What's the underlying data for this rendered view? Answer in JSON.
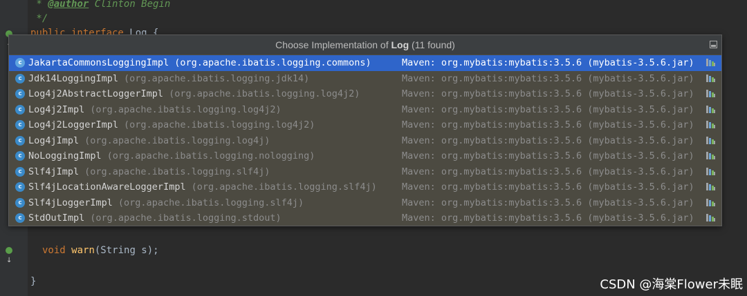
{
  "editor": {
    "comment_author_prefix": " * ",
    "comment_author_tag": "@author",
    "comment_author_name": " Clinton Begin",
    "comment_end": " */",
    "line_decl_kw": "public interface",
    "line_decl_name": " Log {",
    "line_warn_kw": "void",
    "line_warn_fn": "warn",
    "line_warn_rest": "(String s);",
    "closing_brace": "}"
  },
  "popup": {
    "title_prefix": "Choose Implementation of ",
    "title_class": "Log",
    "title_suffix": " (11 found)",
    "items": [
      {
        "name": "JakartaCommonsLoggingImpl",
        "package": "(org.apache.ibatis.logging.commons)",
        "library": "Maven: org.mybatis:mybatis:3.5.6 (mybatis-3.5.6.jar)",
        "selected": true
      },
      {
        "name": "Jdk14LoggingImpl",
        "package": "(org.apache.ibatis.logging.jdk14)",
        "library": "Maven: org.mybatis:mybatis:3.5.6 (mybatis-3.5.6.jar)"
      },
      {
        "name": "Log4j2AbstractLoggerImpl",
        "package": "(org.apache.ibatis.logging.log4j2)",
        "library": "Maven: org.mybatis:mybatis:3.5.6 (mybatis-3.5.6.jar)"
      },
      {
        "name": "Log4j2Impl",
        "package": "(org.apache.ibatis.logging.log4j2)",
        "library": "Maven: org.mybatis:mybatis:3.5.6 (mybatis-3.5.6.jar)"
      },
      {
        "name": "Log4j2LoggerImpl",
        "package": "(org.apache.ibatis.logging.log4j2)",
        "library": "Maven: org.mybatis:mybatis:3.5.6 (mybatis-3.5.6.jar)"
      },
      {
        "name": "Log4jImpl",
        "package": "(org.apache.ibatis.logging.log4j)",
        "library": "Maven: org.mybatis:mybatis:3.5.6 (mybatis-3.5.6.jar)"
      },
      {
        "name": "NoLoggingImpl",
        "package": "(org.apache.ibatis.logging.nologging)",
        "library": "Maven: org.mybatis:mybatis:3.5.6 (mybatis-3.5.6.jar)"
      },
      {
        "name": "Slf4jImpl",
        "package": "(org.apache.ibatis.logging.slf4j)",
        "library": "Maven: org.mybatis:mybatis:3.5.6 (mybatis-3.5.6.jar)"
      },
      {
        "name": "Slf4jLocationAwareLoggerImpl",
        "package": "(org.apache.ibatis.logging.slf4j)",
        "library": "Maven: org.mybatis:mybatis:3.5.6 (mybatis-3.5.6.jar)"
      },
      {
        "name": "Slf4jLoggerImpl",
        "package": "(org.apache.ibatis.logging.slf4j)",
        "library": "Maven: org.mybatis:mybatis:3.5.6 (mybatis-3.5.6.jar)"
      },
      {
        "name": "StdOutImpl",
        "package": "(org.apache.ibatis.logging.stdout)",
        "library": "Maven: org.mybatis:mybatis:3.5.6 (mybatis-3.5.6.jar)"
      }
    ],
    "class_icon_glyph": "c",
    "class_icon": "class-icon",
    "library_icon": "library-icon",
    "pin_icon": "pin-icon"
  },
  "watermark": "CSDN @海棠Flower未眠",
  "colors": {
    "selection": "#2f65ca",
    "popup_bg": "#4c4a41",
    "editor_bg": "#2b2b2b"
  }
}
